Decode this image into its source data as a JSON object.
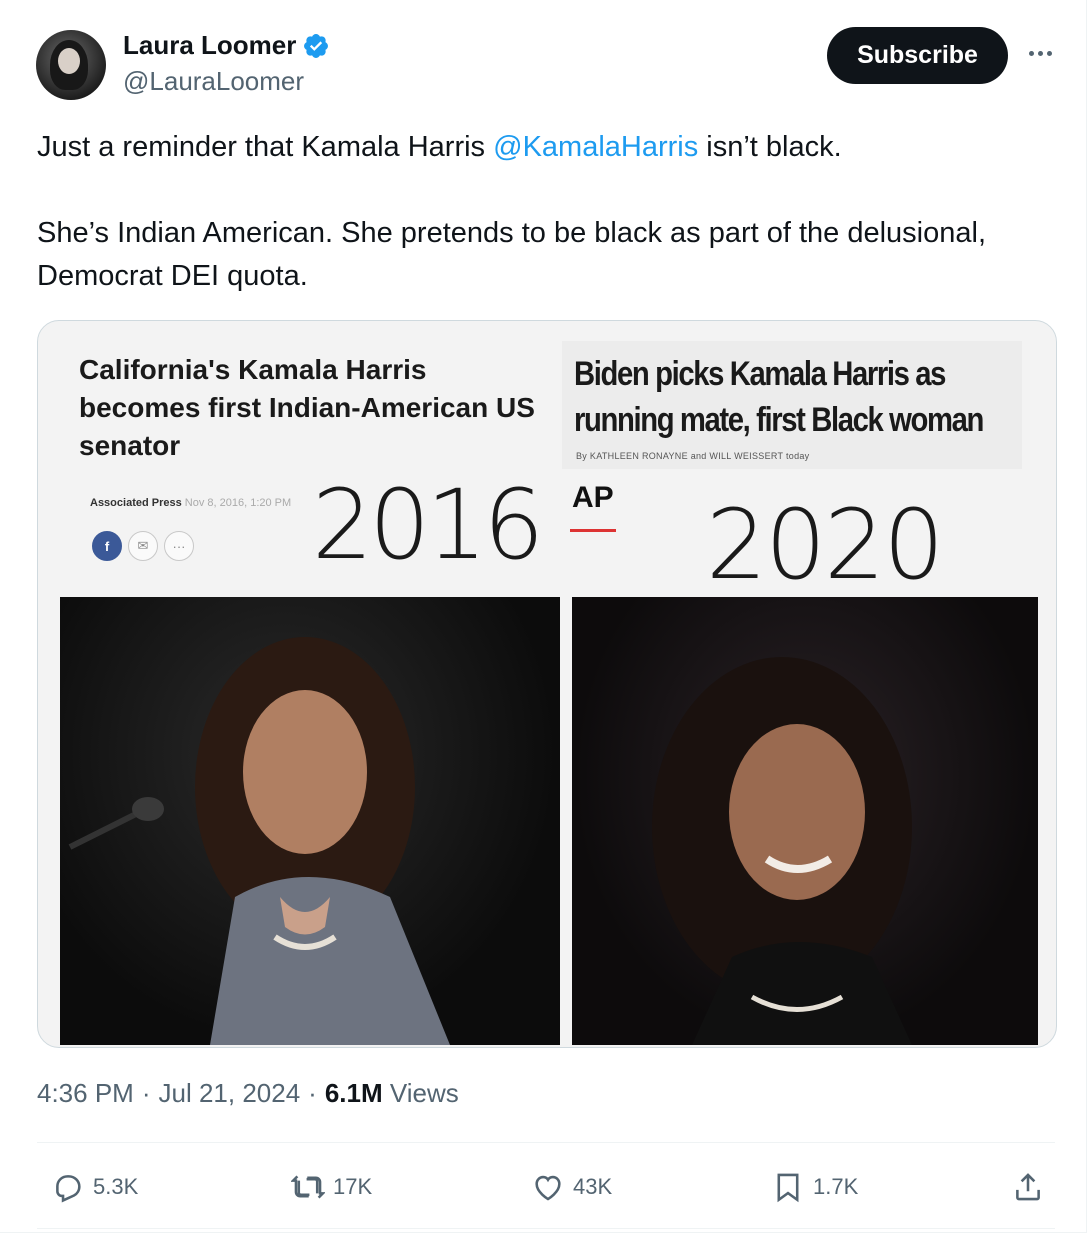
{
  "author": {
    "name": "Laura Loomer",
    "handle": "@LauraLoomer",
    "verified_icon": "verified-badge-icon",
    "verified_color": "#1d9bf0"
  },
  "header": {
    "subscribe_label": "Subscribe",
    "more_icon": "more-horizontal-icon"
  },
  "tweet": {
    "line1_before": "Just a reminder that Kamala Harris ",
    "mention": "@KamalaHarris",
    "line1_after": " isn’t black.",
    "paragraph2": "She’s Indian American. She pretends to be black as part of the delusional, Democrat DEI quota."
  },
  "media": {
    "left_headline": "California's Kamala Harris becomes first Indian-American US senator",
    "left_source": "Associated Press",
    "left_timestamp": "Nov 8, 2016, 1:20 PM",
    "left_year": "2016",
    "right_headline_line1": "Biden picks Kamala Harris as",
    "right_headline_line2": "running mate, first Black woman",
    "right_byline": "By KATHLEEN RONAYNE and WILL WEISSERT   today",
    "right_source": "AP",
    "right_year": "2020"
  },
  "meta": {
    "time": "4:36 PM",
    "dot": "·",
    "date": "Jul 21, 2024",
    "views_count": "6.1M",
    "views_label": "Views"
  },
  "actions": {
    "replies": "5.3K",
    "reposts": "17K",
    "likes": "43K",
    "bookmarks": "1.7K"
  },
  "colors": {
    "link": "#1d9bf0",
    "text": "#0f1419",
    "secondary": "#536471",
    "button_bg": "#0f1419"
  }
}
